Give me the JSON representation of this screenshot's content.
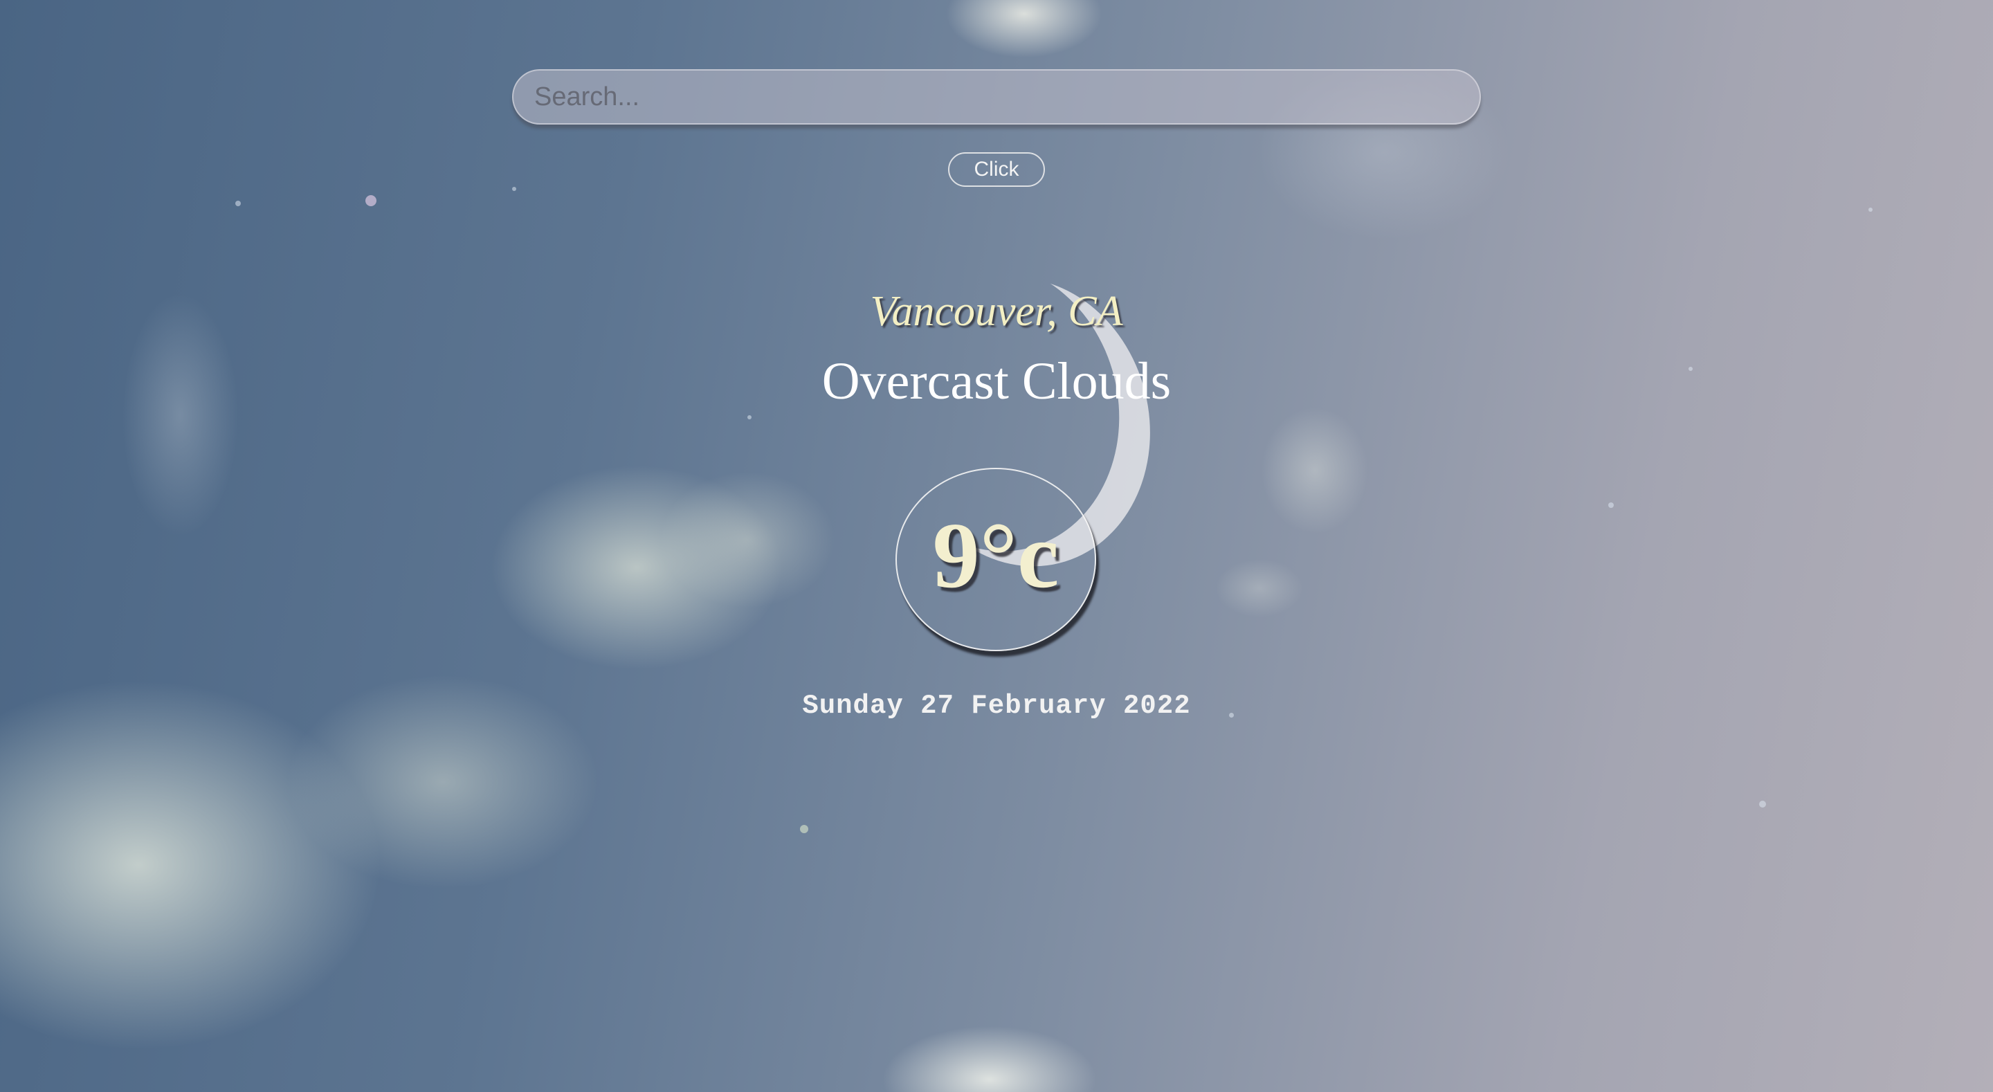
{
  "search": {
    "placeholder": "Search...",
    "button_label": "Click"
  },
  "weather": {
    "city": "Vancouver, CA",
    "condition": "Overcast Clouds",
    "temperature": "9°c",
    "date": "Sunday 27 February 2022"
  },
  "colors": {
    "city_text": "#f3efc4",
    "temperature_text": "#f3efcf",
    "condition_text": "#ffffff"
  }
}
